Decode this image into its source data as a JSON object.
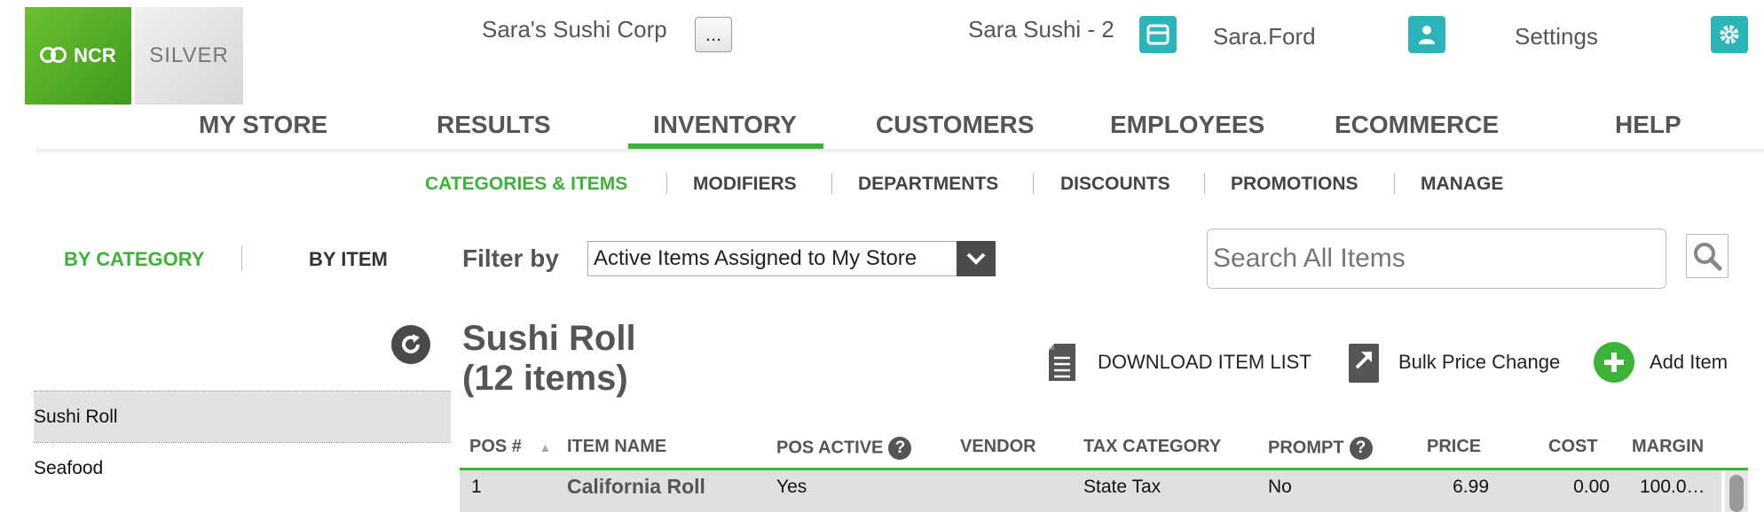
{
  "header": {
    "company": "Sara's Sushi Corp",
    "more_label": "...",
    "store": "Sara Sushi - 2",
    "user": "Sara.Ford",
    "settings": "Settings",
    "logo_primary": "NCR",
    "logo_secondary": "SILVER",
    "store_icon": "store-icon",
    "user_icon": "user-icon",
    "settings_icon": "gear-icon"
  },
  "nav": {
    "items": [
      "MY STORE",
      "RESULTS",
      "INVENTORY",
      "CUSTOMERS",
      "EMPLOYEES",
      "ECOMMERCE",
      "HELP"
    ],
    "active": "INVENTORY"
  },
  "subnav": {
    "items": [
      "CATEGORIES & ITEMS",
      "MODIFIERS",
      "DEPARTMENTS",
      "DISCOUNTS",
      "PROMOTIONS",
      "MANAGE"
    ],
    "active": "CATEGORIES & ITEMS"
  },
  "view_toggle": {
    "by_category": "BY CATEGORY",
    "by_item": "BY ITEM",
    "active": "BY CATEGORY"
  },
  "filter": {
    "label": "Filter by",
    "selected": "Active Items Assigned to My Store"
  },
  "search": {
    "placeholder": "Search All Items"
  },
  "categories": [
    "Sushi Roll",
    "Seafood"
  ],
  "selected_category": "Sushi Roll",
  "main": {
    "title": "Sushi Roll",
    "count": "(12 items)",
    "actions": {
      "download": "DOWNLOAD ITEM LIST",
      "bulk": "Bulk Price Change",
      "add": "Add Item"
    }
  },
  "table": {
    "columns": [
      "POS #",
      "ITEM NAME",
      "POS ACTIVE",
      "VENDOR",
      "TAX CATEGORY",
      "PROMPT",
      "PRICE",
      "COST",
      "MARGIN"
    ],
    "sorted_column": "POS #",
    "rows": [
      {
        "pos": "1",
        "name": "California Roll",
        "active": "Yes",
        "vendor": "",
        "tax": "State Tax",
        "prompt": "No",
        "price": "6.99",
        "cost": "0.00",
        "margin": "100.0…"
      }
    ]
  },
  "colors": {
    "accent_green": "#3cb338",
    "teal": "#2bb5b8"
  }
}
